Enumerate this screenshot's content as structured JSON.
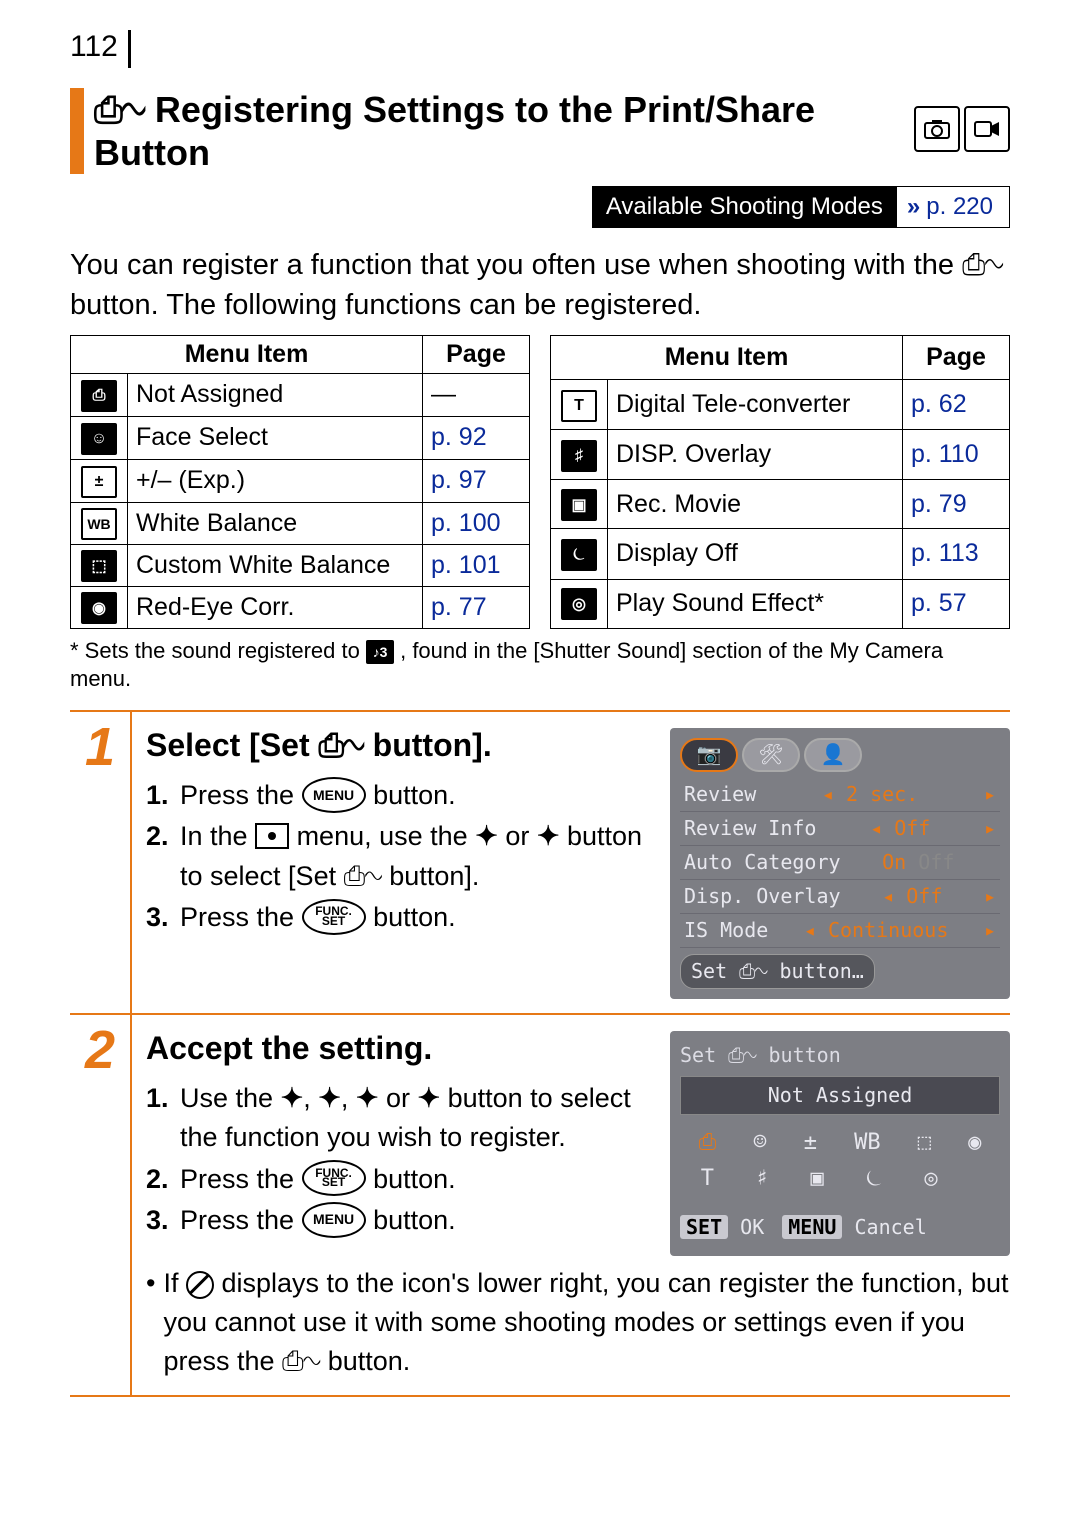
{
  "page_number": "112",
  "title": "Registering Settings to the Print/Share Button",
  "available_modes_label": "Available Shooting Modes",
  "available_modes_page": "p. 220",
  "intro_a": "You can register a function that you often use when shooting with the ",
  "intro_b": " button. The following functions can be registered.",
  "table_headers": {
    "item": "Menu Item",
    "page": "Page"
  },
  "left_items": [
    {
      "name": "Not Assigned",
      "page": "—",
      "link": false
    },
    {
      "name": "Face Select",
      "page": "p. 92",
      "link": true
    },
    {
      "name": "+/– (Exp.)",
      "page": "p. 97",
      "link": true
    },
    {
      "name": "White Balance",
      "page": "p. 100",
      "link": true
    },
    {
      "name": "Custom White Balance",
      "page": "p. 101",
      "link": true
    },
    {
      "name": "Red-Eye Corr.",
      "page": "p. 77",
      "link": true
    }
  ],
  "right_items": [
    {
      "name": "Digital Tele-converter",
      "page": "p. 62",
      "link": true
    },
    {
      "name": "DISP. Overlay",
      "page": "p. 110",
      "link": true
    },
    {
      "name": "Rec. Movie",
      "page": "p. 79",
      "link": true
    },
    {
      "name": "Display Off",
      "page": "p. 113",
      "link": true
    },
    {
      "name": "Play Sound Effect*",
      "page": "p. 57",
      "link": true
    }
  ],
  "left_icons": [
    "⎙",
    "☺",
    "±",
    "WB",
    "⬚",
    "◉"
  ],
  "right_icons": [
    "T",
    "♯",
    "▣",
    "⏾",
    "◎"
  ],
  "footnote_a": "* Sets the sound registered to ",
  "footnote_b": ", found in the [Shutter Sound] section of the My Camera menu.",
  "step1": {
    "num": "1",
    "title_a": "Select [Set ",
    "title_b": " button].",
    "l1a": "Press the ",
    "l1b": " button.",
    "l2a": "In the ",
    "l2b": " menu, use the ",
    "l2c": " or ",
    "l2d": " button to select [Set ",
    "l2e": " button].",
    "l3a": "Press the ",
    "l3b": " button."
  },
  "lcd1": {
    "r1": {
      "label": "Review",
      "val": "2 sec."
    },
    "r2": {
      "label": "Review Info",
      "val": "Off"
    },
    "r3": {
      "label": "Auto Category",
      "val": "On",
      "val2": "Off"
    },
    "r4": {
      "label": "Disp. Overlay",
      "val": "Off"
    },
    "r5": {
      "label": "IS Mode",
      "val": "Continuous"
    },
    "set": "Set ⎙∿ button…"
  },
  "step2": {
    "num": "2",
    "title": "Accept the setting.",
    "l1": "Use the ",
    "l1b": " button to select the function you wish to register.",
    "l2a": "Press the ",
    "l2b": " button.",
    "l3a": "Press the ",
    "l3b": " button.",
    "note_a": "If ",
    "note_b": " displays to the icon's lower right, you can register the function, but you cannot use it with some shooting modes or settings even if you press the ",
    "note_c": " button."
  },
  "lcd2": {
    "hdr": "Set ⎙∿ button",
    "sel": "Not Assigned",
    "ok": "OK",
    "cancel": "Cancel",
    "set": "SET",
    "menu": "MENU"
  },
  "print_share_glyph": "⎙∿",
  "menu_btn": "MENU",
  "func_btn_a": "FUNC.",
  "func_btn_b": "SET",
  "nums": {
    "n1": "1.",
    "n2": "2.",
    "n3": "3."
  },
  "arrows": {
    "up": "✦",
    "down": "✦",
    "left": "✦",
    "right": "✦"
  },
  "conj_or": " or ",
  "conj_comma": ", "
}
